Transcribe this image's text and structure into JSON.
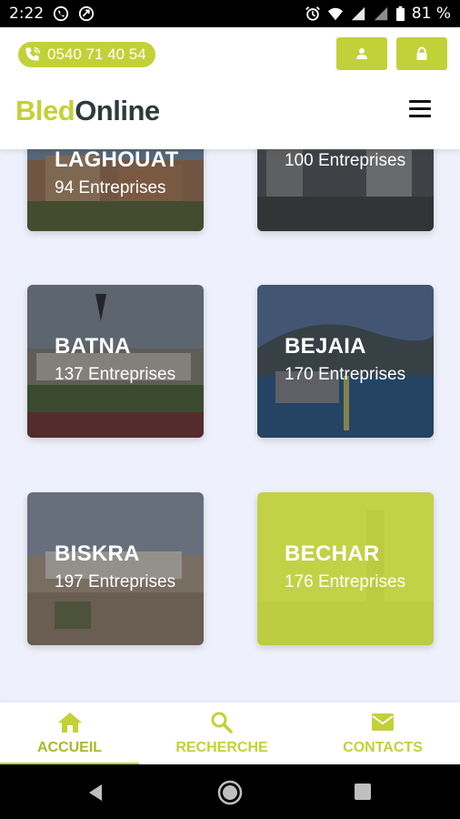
{
  "status_bar": {
    "time": "2:22",
    "battery": "81 %"
  },
  "header": {
    "phone": "0540 71 40 54",
    "logo_part1": "Bled",
    "logo_part2": "Online",
    "accent_color": "#c2d137"
  },
  "cards": [
    {
      "city": "LAGHOUAT",
      "count": "94 Entreprises"
    },
    {
      "city": "",
      "count": "100 Entreprises"
    },
    {
      "city": "BATNA",
      "count": "137 Entreprises"
    },
    {
      "city": "BEJAIA",
      "count": "170 Entreprises"
    },
    {
      "city": "BISKRA",
      "count": "197 Entreprises"
    },
    {
      "city": "BECHAR",
      "count": "176 Entreprises"
    }
  ],
  "bottom_nav": {
    "items": [
      {
        "label": "ACCUEIL",
        "icon": "home-icon"
      },
      {
        "label": "RECHERCHE",
        "icon": "search-icon"
      },
      {
        "label": "CONTACTS",
        "icon": "mail-icon"
      }
    ]
  }
}
